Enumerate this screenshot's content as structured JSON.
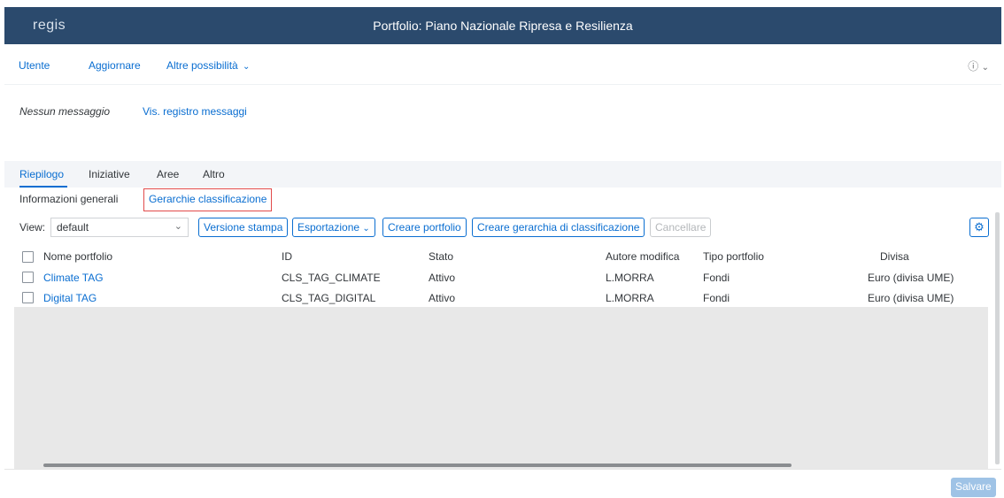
{
  "shell": {
    "logo": "regis",
    "title": "Portfolio: Piano Nazionale Ripresa e Resilienza"
  },
  "toolbar": {
    "user": "Utente",
    "refresh": "Aggiornare",
    "more": "Altre possibilità",
    "help_icon": "help-circle-icon"
  },
  "messages": {
    "none": "Nessun messaggio",
    "log_link": "Vis. registro messaggi"
  },
  "tabs": [
    "Riepilogo",
    "Iniziative",
    "Aree",
    "Altro"
  ],
  "subtabs": {
    "general": "Informazioni generali",
    "hierarchies": "Gerarchie classificazione"
  },
  "table_toolbar": {
    "view_label": "View:",
    "view_value": "default",
    "print": "Versione stampa",
    "export": "Esportazione",
    "create_portfolio": "Creare portfolio",
    "create_hierarchy": "Creare gerarchia di classificazione",
    "delete": "Cancellare",
    "settings_icon": "gear-icon"
  },
  "table": {
    "headers": [
      "Nome portfolio",
      "ID",
      "Stato",
      "Autore modifica",
      "Tipo portfolio",
      "Divisa"
    ],
    "rows": [
      [
        "Climate TAG",
        "CLS_TAG_CLIMATE",
        "Attivo",
        "L.MORRA",
        "Fondi",
        "Euro (divisa UME)"
      ],
      [
        "Digital TAG",
        "CLS_TAG_DIGITAL",
        "Attivo",
        "L.MORRA",
        "Fondi",
        "Euro (divisa UME)"
      ]
    ]
  },
  "footer": {
    "save": "Salvare"
  },
  "colors": {
    "shell": "#2b4a6d",
    "accent": "#0a6ed1",
    "highlight": "#e24b4b"
  }
}
